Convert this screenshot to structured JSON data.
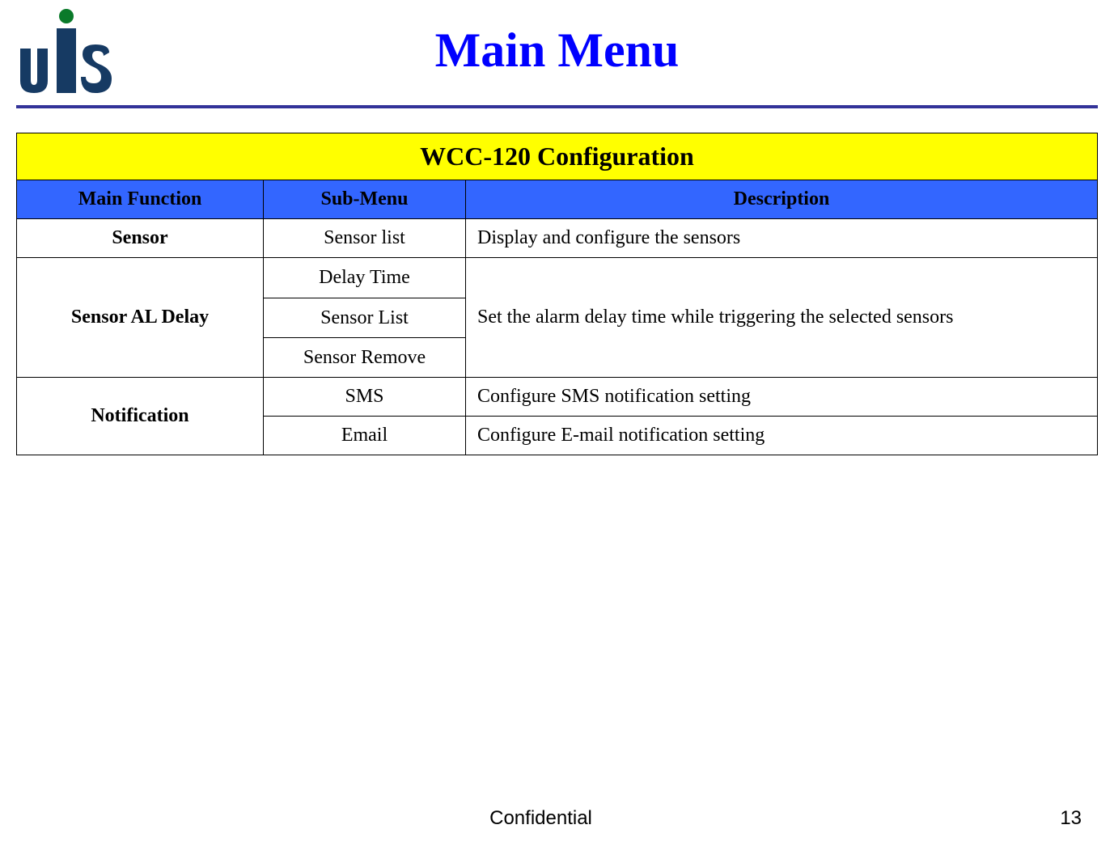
{
  "page": {
    "title": "Main Menu",
    "logo_text": "UIS",
    "footer_center": "Confidential",
    "footer_right": "13"
  },
  "table": {
    "title": "WCC-120 Configuration",
    "headers": {
      "main": "Main Function",
      "sub": "Sub-Menu",
      "desc": "Description"
    },
    "rows": {
      "sensor": {
        "main": "Sensor",
        "sub": "Sensor list",
        "desc": "Display and configure the sensors"
      },
      "delay": {
        "main": "Sensor AL Delay",
        "sub1": "Delay Time",
        "sub2": "Sensor List",
        "sub3": "Sensor Remove",
        "desc": "Set the alarm delay time while triggering the selected sensors"
      },
      "notif": {
        "main": "Notification",
        "sub_sms": "SMS",
        "desc_sms": "Configure SMS notification setting",
        "sub_email": "Email",
        "desc_email": "Configure E-mail notification setting"
      }
    }
  }
}
